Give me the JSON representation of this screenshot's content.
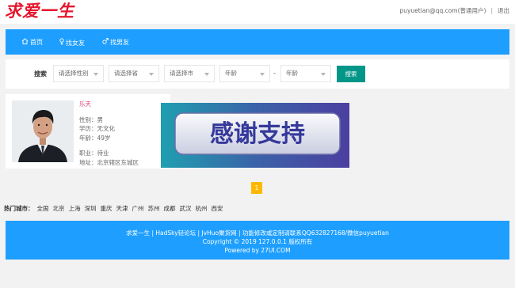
{
  "header": {
    "logo": "求爱一生",
    "user": "puyuetian@qq.com(普通用户)",
    "divider": "|",
    "logout": "退出"
  },
  "nav": {
    "items": [
      {
        "icon": "home-icon",
        "label": "首页"
      },
      {
        "icon": "female-icon",
        "label": "找女友"
      },
      {
        "icon": "male-icon",
        "label": "找男友"
      }
    ]
  },
  "search": {
    "label": "搜索",
    "gender_placeholder": "请选择性别",
    "province_placeholder": "请选择省",
    "city_placeholder": "请选择市",
    "age_from_placeholder": "年龄",
    "dash": "-",
    "age_to_placeholder": "年龄",
    "button": "搜索"
  },
  "profile": {
    "name": "乐天",
    "gender": "性别：男",
    "education": "学历：无文化",
    "age": "年龄：49岁",
    "job": "职业：待业",
    "address": "地址：北京辖区东城区"
  },
  "banner": {
    "text": "感谢支持"
  },
  "pagination": {
    "current": "1"
  },
  "cities": {
    "label": "热门城市：",
    "items": [
      "全国",
      "北京",
      "上海",
      "深圳",
      "重庆",
      "天津",
      "广州",
      "苏州",
      "成都",
      "武汉",
      "杭州",
      "西安"
    ]
  },
  "footer": {
    "links": [
      "求爱一生",
      "HadSky轻论坛",
      "JvHuo聚货网",
      "功能修改或定制请联系QQ632827168/微信puyuetian"
    ],
    "copyright": "Copyright © 2019 127.0.0.1 版权所有",
    "powered": "Powered by 27UI.COM"
  },
  "colors": {
    "nav_bg": "#1e9fff",
    "logo": "#e4172d",
    "search_button": "#009688",
    "pager_active": "#ffb800",
    "profile_name": "#e0457b"
  }
}
